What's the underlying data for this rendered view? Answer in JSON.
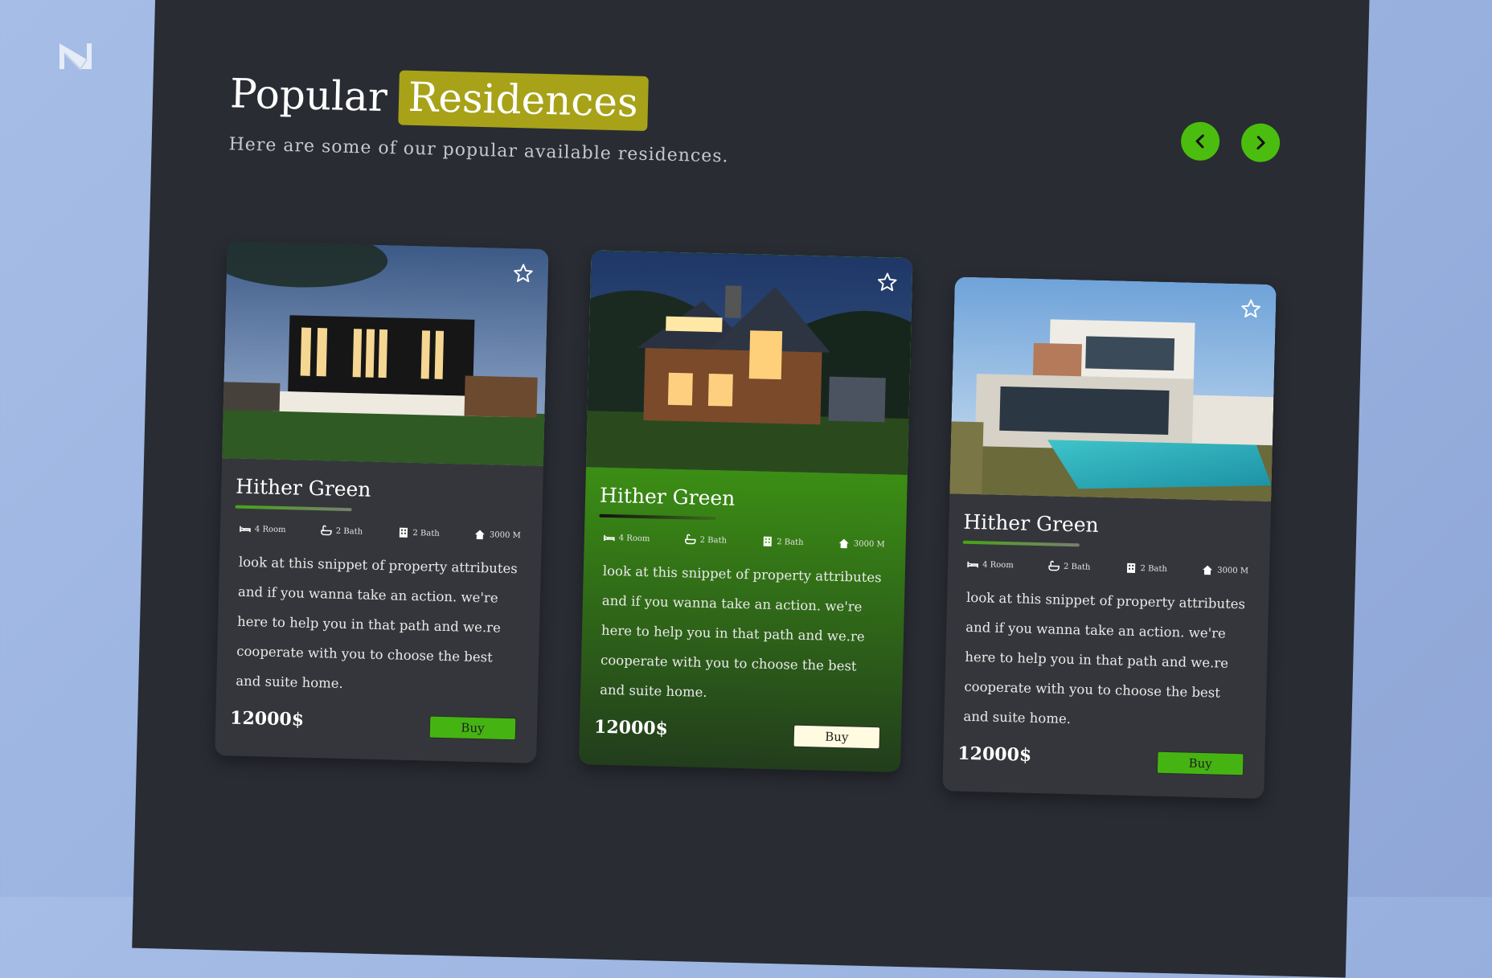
{
  "header": {
    "title_word": "Popular",
    "title_highlight": "Residences",
    "subtitle": "Here are some of our popular available residences."
  },
  "nav": {
    "prev_icon": "chevron-left-icon",
    "next_icon": "chevron-right-icon"
  },
  "colors": {
    "panel": "#292c33",
    "accent_green": "#4bbd0e",
    "highlight": "#a7a218",
    "card_bg": "#35363b"
  },
  "cards": [
    {
      "name": "Hither Green",
      "attrs": [
        "4 Room",
        "2 Bath",
        "2 Bath",
        "3000 M"
      ],
      "description": "look at this snippet of property attributes and if you wanna take an action. we're here to help you in that path and we.re cooperate with you to choose the best and suite home.",
      "price": "12000$",
      "buy_label": "Buy",
      "photo": "modern-house-dusk"
    },
    {
      "name": "Hither Green",
      "attrs": [
        "4 Room",
        "2 Bath",
        "2 Bath",
        "3000 M"
      ],
      "description": "look at this snippet of property attributes and if you wanna take an action. we're here to help you in that path and we.re cooperate with you to choose the best and suite home.",
      "price": "12000$",
      "buy_label": "Buy",
      "photo": "wooden-chalet-evening"
    },
    {
      "name": "Hither Green",
      "attrs": [
        "4 Room",
        "2 Bath",
        "2 Bath",
        "3000 M"
      ],
      "description": "look at this snippet of property attributes and if you wanna take an action. we're here to help you in that path and we.re cooperate with you to choose the best and suite home.",
      "price": "12000$",
      "buy_label": "Buy",
      "photo": "villa-with-pool"
    }
  ]
}
